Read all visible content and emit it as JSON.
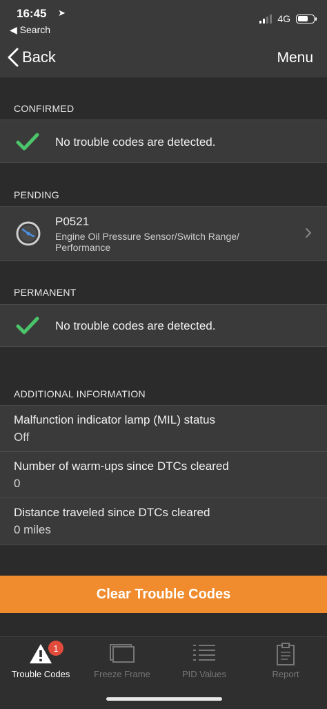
{
  "status": {
    "time": "16:45",
    "back_app": "◀ Search",
    "network": "4G"
  },
  "nav": {
    "back_label": "Back",
    "menu_label": "Menu"
  },
  "sections": {
    "confirmed": {
      "header": "CONFIRMED",
      "message": "No trouble codes are detected."
    },
    "pending": {
      "header": "PENDING",
      "code": "P0521",
      "description": "Engine Oil Pressure Sensor/Switch Range/ Performance"
    },
    "permanent": {
      "header": "PERMANENT",
      "message": "No trouble codes are detected."
    }
  },
  "additional": {
    "header": "ADDITIONAL INFORMATION",
    "items": [
      {
        "label": "Malfunction indicator lamp (MIL) status",
        "value": "Off"
      },
      {
        "label": "Number of warm-ups since DTCs cleared",
        "value": "0"
      },
      {
        "label": "Distance traveled since DTCs cleared",
        "value": "0 miles"
      }
    ]
  },
  "actions": {
    "clear_label": "Clear Trouble Codes"
  },
  "tabs": [
    {
      "label": "Trouble Codes",
      "badge": "1",
      "icon": "warning-icon"
    },
    {
      "label": "Freeze Frame",
      "icon": "freeze-frame-icon"
    },
    {
      "label": "PID Values",
      "icon": "list-icon"
    },
    {
      "label": "Report",
      "icon": "clipboard-icon"
    }
  ],
  "colors": {
    "accent": "#f08c2e",
    "check": "#4cc46a",
    "badge": "#e14b3b",
    "background": "#2b2b2b",
    "row": "#3a3a3a"
  }
}
